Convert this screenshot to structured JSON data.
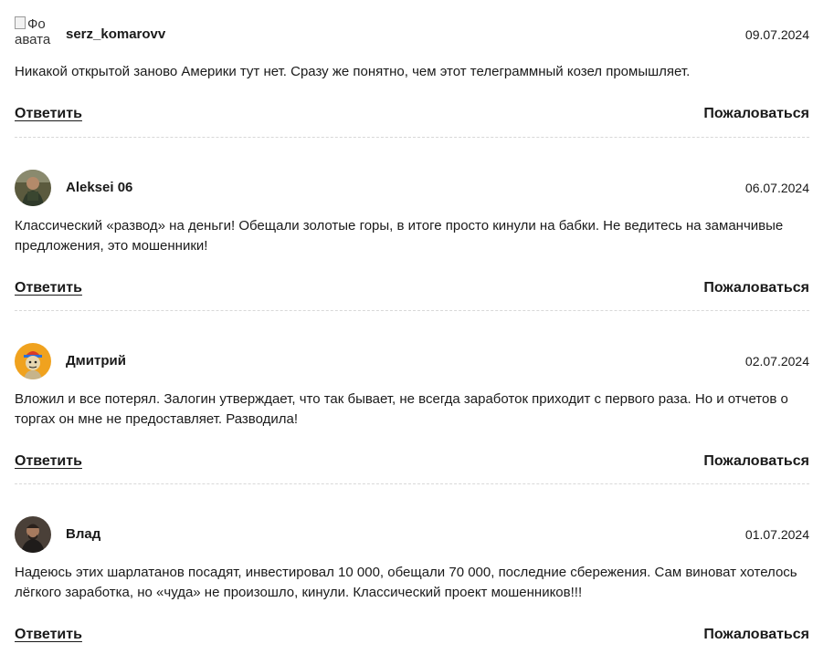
{
  "comments": [
    {
      "author": "serz_komarovv",
      "date": "09.07.2024",
      "avatar_alt": "Фото аватара",
      "avatar_alt_visible": "Фо\nавата",
      "text": "Никакой открытой заново Америки тут нет. Сразу же понятно, чем этот телеграммный козел промышляет.",
      "reply_label": "Ответить",
      "report_label": "Пожаловаться"
    },
    {
      "author": "Aleksei 06",
      "date": "06.07.2024",
      "text": "Классический «развод» на деньги! Обещали золотые горы, в итоге просто кинули на бабки. Не ведитесь на заманчивые предложения, это мошенники!",
      "reply_label": "Ответить",
      "report_label": "Пожаловаться"
    },
    {
      "author": "Дмитрий",
      "date": "02.07.2024",
      "text": "Вложил и все потерял. Залогин утверждает, что так бывает, не всегда заработок приходит с первого раза. Но и отчетов о торгах он мне не предоставляет. Разводила!",
      "reply_label": "Ответить",
      "report_label": "Пожаловаться"
    },
    {
      "author": "Влад",
      "date": "01.07.2024",
      "text": "Надеюсь этих шарлатанов посадят, инвестировал 10 000, обещали 70 000, последние сбережения. Сам виноват хотелось лёгкого заработка, но «чуда» не произошло, кинули. Классический проект мошенников!!!",
      "reply_label": "Ответить",
      "report_label": "Пожаловаться"
    }
  ],
  "colors": {
    "text": "#1a1a1a",
    "divider": "#d8d8d8",
    "avatar_dmitry_bg": "#f0a21e"
  }
}
